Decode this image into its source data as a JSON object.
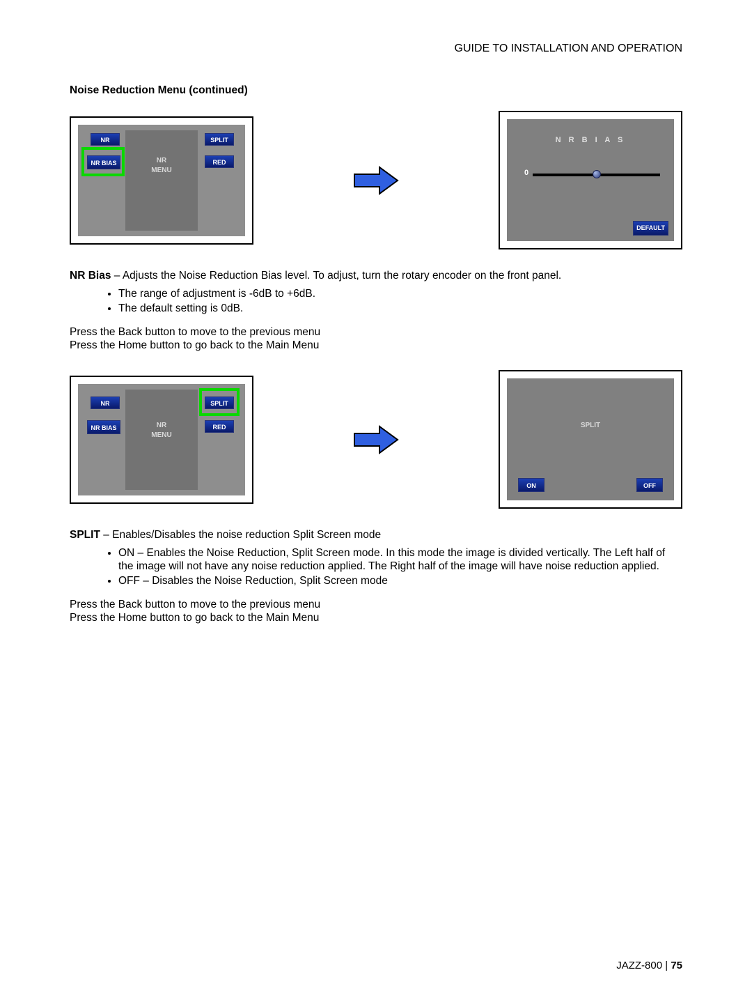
{
  "header": {
    "title": "GUIDE TO INSTALLATION AND OPERATION"
  },
  "section": {
    "title": "Noise Reduction Menu (continued)"
  },
  "menu": {
    "nr": "NR",
    "nr_bias": "NR BIAS",
    "split": "SPLIT",
    "red": "RED",
    "center_line1": "NR",
    "center_line2": "MENU"
  },
  "bias_screen": {
    "title": "N R  B I A S",
    "value": "0",
    "default_btn": "DEFAULT"
  },
  "split_screen": {
    "title": "SPLIT",
    "on": "ON",
    "off": "OFF"
  },
  "nr_bias_text": {
    "bold": "NR Bias",
    "rest": " – Adjusts the Noise Reduction Bias level. To adjust, turn the rotary encoder on the front panel.",
    "bullet1": "The range of adjustment is -6dB to +6dB.",
    "bullet2": "The default setting is 0dB."
  },
  "nav": {
    "back": "Press the Back button to move to the previous menu",
    "home": "Press the Home button to go back to the Main Menu"
  },
  "split_text": {
    "bold": "SPLIT",
    "rest": " – Enables/Disables the noise reduction Split Screen mode",
    "on_line": "ON – Enables the Noise Reduction, Split Screen mode. In this mode the image is divided vertically. The Left half of the image will not have any noise reduction applied. The Right half of the image will have noise reduction applied.",
    "off_line": "OFF – Disables the Noise Reduction, Split Screen mode"
  },
  "footer": {
    "product": "JAZZ-800",
    "sep": "  |  ",
    "page": "75"
  }
}
